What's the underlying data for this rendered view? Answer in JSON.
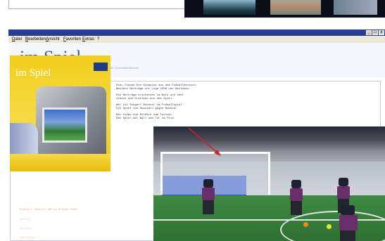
{
  "colors": {
    "titlebar": "#263d96",
    "logo": "#2f5fb6",
    "highlight_text": "#ff9f80",
    "cover_yellow": "#f2cf1d",
    "field_green": "#3f8a44",
    "arrow": "#d0202a"
  },
  "window": {
    "controls": [
      "_",
      "□",
      "x"
    ]
  },
  "menu": {
    "items": [
      "Datei",
      "Bearbeiten",
      "Ansicht",
      "Favoriten",
      "Extras",
      "?"
    ]
  },
  "site": {
    "logo": "im Spiel",
    "tagline": "Ein Magazin der Fußballwissenschaft an der Universität Münster"
  },
  "cover": {
    "title": "im Spiel"
  },
  "article": {
    "lines": [
      "Hier finden Sie Hinweise aus dem Fußballbereich.",
      "Weitere Beiträge zur Liga 2006 und Aktionen.",
      "Die Beiträge erscheinen im Netz und über",
      "Videos und Grafiken aus dem Spiel.",
      "Wer ist Sieger? Roboter im Fußballspiel.",
      "Ein Spiel von Robotern gegen Roboter.",
      "Mit Video und Bildern vom Turnier.",
      "Das Spiel mit Ball und Tor im Feld."
    ],
    "links": [
      "Fußball: Roboter-WM in Bremen 2006",
      "Archiv",
      "Kontakt",
      "Impressum"
    ]
  },
  "icons": {
    "minimize": "minimize-icon",
    "maximize": "maximize-icon",
    "close": "close-icon",
    "arrow": "arrow-annotation-icon"
  }
}
